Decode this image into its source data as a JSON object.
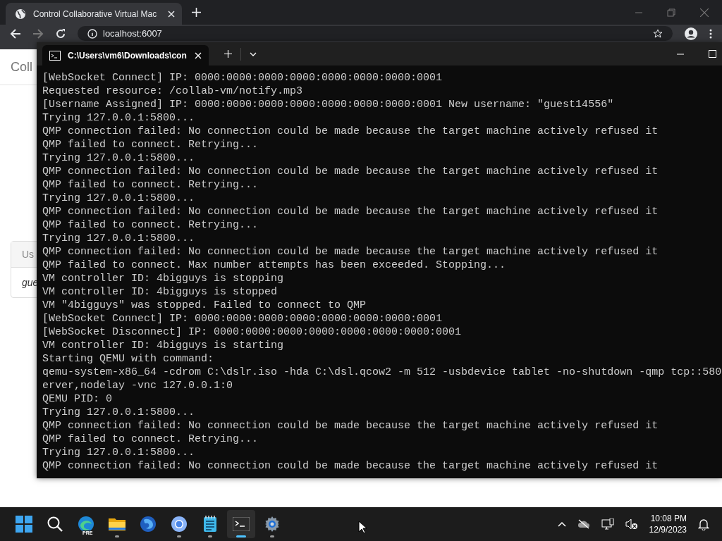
{
  "browser": {
    "tab_title": "Control Collaborative Virtual Mac",
    "address": "localhost:6007",
    "page_heading": "Coll",
    "card_label": "Us",
    "card_value": "gue"
  },
  "terminal": {
    "tab_title": "C:\\Users\\vm6\\Downloads\\con",
    "lines": [
      "[WebSocket Connect] IP: 0000:0000:0000:0000:0000:0000:0000:0001",
      "Requested resource: /collab-vm/notify.mp3",
      "[Username Assigned] IP: 0000:0000:0000:0000:0000:0000:0000:0001 New username: \"guest14556\"",
      "Trying 127.0.0.1:5800...",
      "QMP connection failed: No connection could be made because the target machine actively refused it",
      "QMP failed to connect. Retrying...",
      "Trying 127.0.0.1:5800...",
      "QMP connection failed: No connection could be made because the target machine actively refused it",
      "QMP failed to connect. Retrying...",
      "Trying 127.0.0.1:5800...",
      "QMP connection failed: No connection could be made because the target machine actively refused it",
      "QMP failed to connect. Retrying...",
      "Trying 127.0.0.1:5800...",
      "QMP connection failed: No connection could be made because the target machine actively refused it",
      "QMP failed to connect. Max number attempts has been exceeded. Stopping...",
      "VM controller ID: 4bigguys is stopping",
      "VM controller ID: 4bigguys is stopped",
      "VM \"4bigguys\" was stopped. Failed to connect to QMP",
      "[WebSocket Connect] IP: 0000:0000:0000:0000:0000:0000:0000:0001",
      "[WebSocket Disconnect] IP: 0000:0000:0000:0000:0000:0000:0000:0001",
      "VM controller ID: 4bigguys is starting",
      "Starting QEMU with command:",
      "qemu-system-x86_64 -cdrom C:\\dslr.iso -hda C:\\dsl.qcow2 -m 512 -usbdevice tablet -no-shutdown -qmp tcp::580",
      "erver,nodelay -vnc 127.0.0.1:0",
      "QEMU PID: 0",
      "Trying 127.0.0.1:5800...",
      "QMP connection failed: No connection could be made because the target machine actively refused it",
      "QMP failed to connect. Retrying...",
      "Trying 127.0.0.1:5800...",
      "QMP connection failed: No connection could be made because the target machine actively refused it"
    ]
  },
  "taskbar": {
    "apps": [
      {
        "kind": "start",
        "running": false,
        "selected": false
      },
      {
        "kind": "search",
        "running": false,
        "selected": false
      },
      {
        "kind": "edge",
        "badge": "PRE",
        "running": false,
        "selected": false
      },
      {
        "kind": "folder",
        "running": true,
        "selected": false
      },
      {
        "kind": "firefox",
        "running": false,
        "selected": false
      },
      {
        "kind": "chrome",
        "running": true,
        "selected": false
      },
      {
        "kind": "notepad",
        "running": true,
        "selected": false
      },
      {
        "kind": "terminal",
        "running": true,
        "selected": true
      },
      {
        "kind": "settings",
        "running": true,
        "selected": false
      }
    ],
    "time": "10:08 PM",
    "date": "12/9/2023"
  }
}
